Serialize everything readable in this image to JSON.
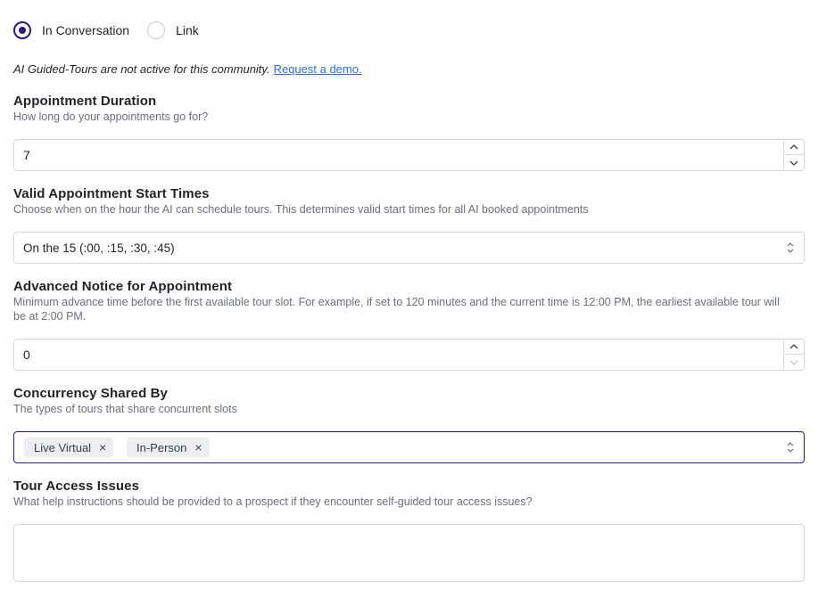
{
  "booking_mode": {
    "options": [
      {
        "label": "In Conversation",
        "selected": true
      },
      {
        "label": "Link",
        "selected": false
      }
    ]
  },
  "notice": {
    "text": "AI Guided-Tours are not active for this community.",
    "link": "Request a demo."
  },
  "duration": {
    "title": "Appointment Duration",
    "description": "How long do your appointments go for?",
    "value": "7"
  },
  "start_times": {
    "title": "Valid Appointment Start Times",
    "description": "Choose when on the hour the AI can schedule tours. This determines valid start times for all AI booked appointments",
    "selected": "On the 15 (:00, :15, :30, :45)"
  },
  "advance_notice": {
    "title": "Advanced Notice for Appointment",
    "description": "Minimum advance time before the first available tour slot. For example, if set to 120 minutes and the current time is 12:00 PM, the earliest available tour will be at 2:00 PM.",
    "value": "0"
  },
  "concurrency": {
    "title": "Concurrency Shared By",
    "description": "The types of tours that share concurrent slots",
    "chips": [
      "Live Virtual",
      "In-Person"
    ]
  },
  "access_issues": {
    "title": "Tour Access Issues",
    "description": "What help instructions should be provided to a prospect if they encounter self-guided tour access issues?",
    "value": ""
  },
  "icons": {
    "stepper_up": "chevron-up-icon",
    "stepper_down": "chevron-down-icon",
    "select": "select-arrows-icon",
    "chip_remove": "close-icon"
  },
  "colors": {
    "accent": "#2e1a74",
    "link": "#2f6fd6",
    "muted_text": "#6b7078",
    "border": "#d5d8dc",
    "chip_bg": "#eceef1"
  }
}
